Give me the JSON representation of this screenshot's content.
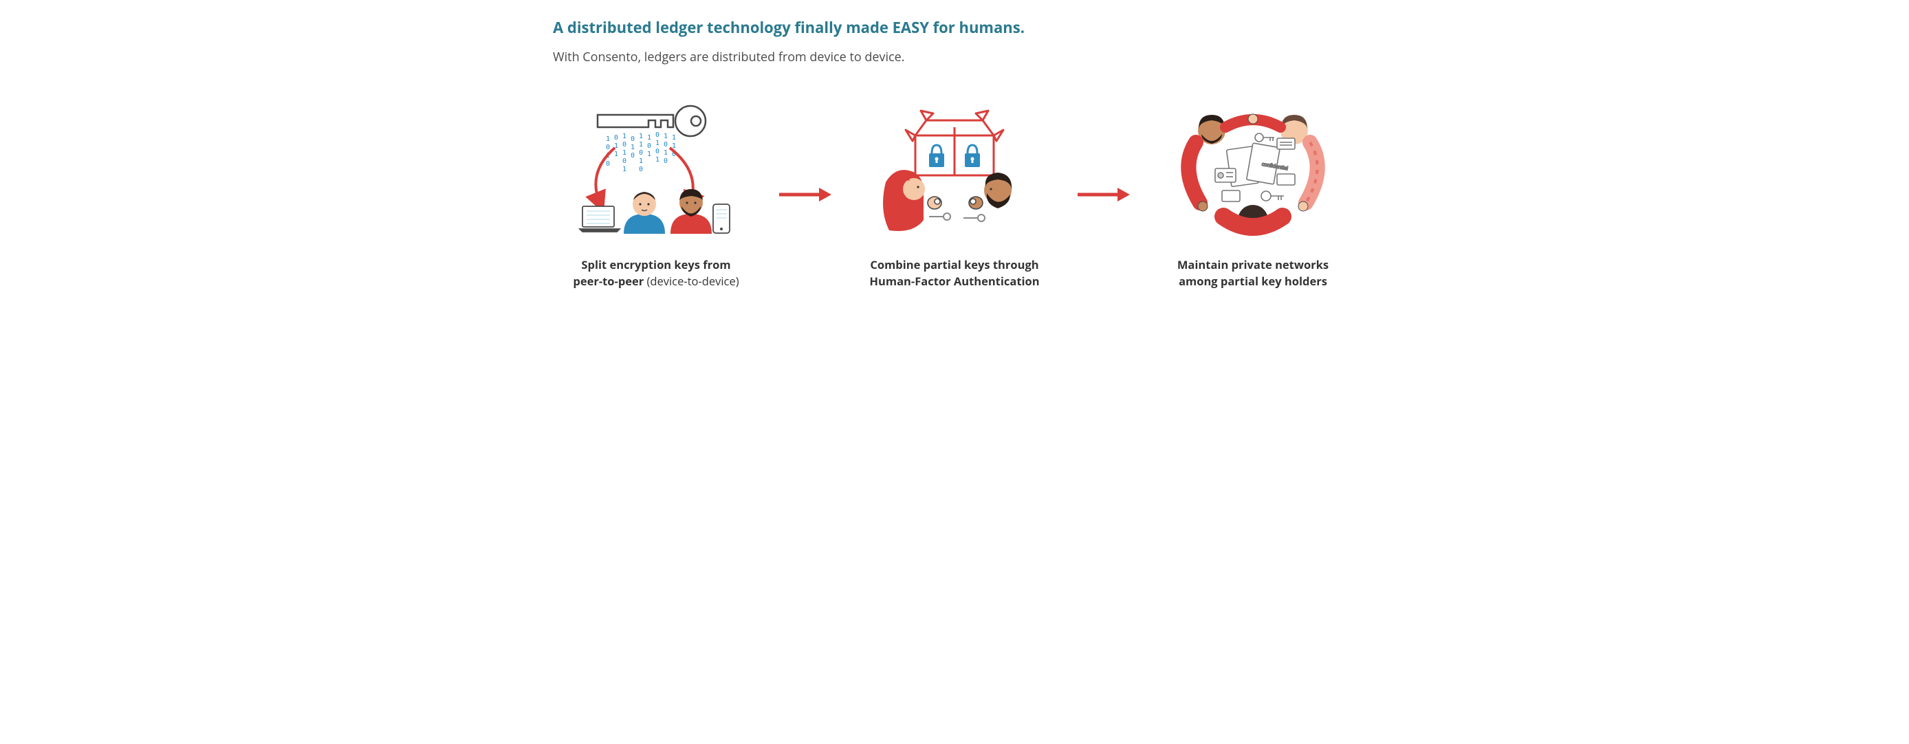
{
  "header": {
    "title": "A distributed ledger technology finally made EASY for humans.",
    "subtitle": "With Consento, ledgers are distributed from device to device."
  },
  "steps": [
    {
      "caption_bold1": "Split encryption keys from",
      "caption_bold2": "peer-to-peer",
      "caption_light": " (device-to-device)",
      "icon": "split-key-icon"
    },
    {
      "caption_line1": "Combine partial keys through",
      "caption_line2": "Human-Factor Authentication",
      "icon": "combine-keys-icon"
    },
    {
      "caption_line1": "Maintain private networks",
      "caption_line2": "among partial key holders",
      "icon": "private-network-icon"
    }
  ],
  "arrow_label": "next-step"
}
